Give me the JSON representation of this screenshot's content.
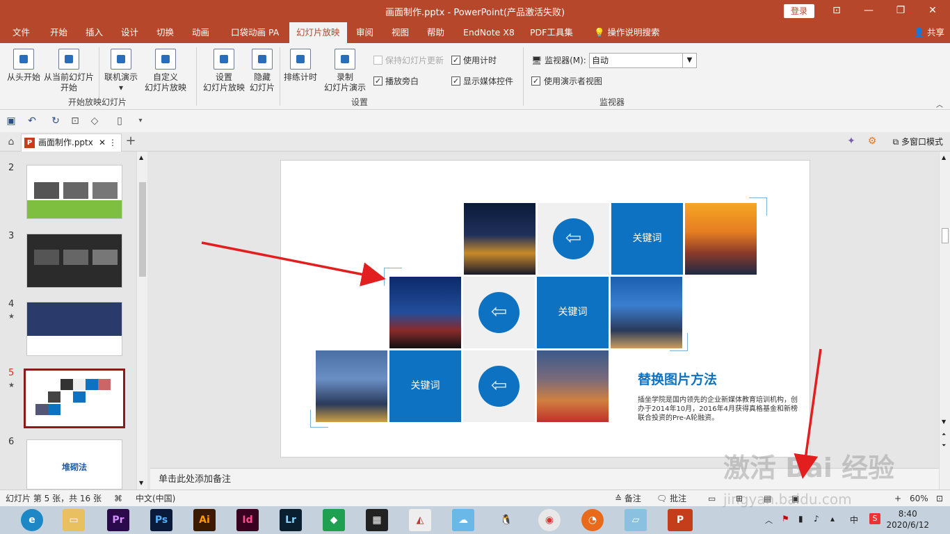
{
  "window": {
    "title": "画面制作.pptx  -  PowerPoint(产品激活失败)",
    "login_label": "登录",
    "minimize": "—",
    "restore": "❐",
    "close": "✕",
    "ribbon_display": "⊡"
  },
  "menu": {
    "tabs": [
      "文件",
      "开始",
      "插入",
      "设计",
      "切换",
      "动画",
      "口袋动画 PA",
      "幻灯片放映",
      "审阅",
      "视图",
      "帮助",
      "EndNote X8",
      "PDF工具集",
      "操作说明搜索"
    ],
    "active_tab": "幻灯片放映",
    "share": "共享"
  },
  "ribbon": {
    "from_start": "从头开始",
    "from_current_1": "从当前幻灯片",
    "from_current_2": "开始",
    "online_present": "联机演示",
    "custom_show_1": "自定义",
    "custom_show_2": "幻灯片放映",
    "group_start": "开始放映幻灯片",
    "setup_show_1": "设置",
    "setup_show_2": "幻灯片放映",
    "hide_slide_1": "隐藏",
    "hide_slide_2": "幻灯片",
    "rehearse": "排练计时",
    "record_1": "录制",
    "record_2": "幻灯片演示",
    "keep_updated": "保持幻灯片更新",
    "play_narrations": "播放旁白",
    "use_timings": "使用计时",
    "show_media_controls": "显示媒体控件",
    "group_setup": "设置",
    "monitor_label": "监视器(M):",
    "monitor_value": "自动",
    "presenter_view": "使用演示者视图",
    "group_monitors": "监视器"
  },
  "doc": {
    "tab_name": "画面制作.pptx",
    "multi_window": "多窗口模式"
  },
  "thumbnails": [
    {
      "num": "2",
      "star": ""
    },
    {
      "num": "3",
      "star": ""
    },
    {
      "num": "4",
      "star": "★"
    },
    {
      "num": "5",
      "star": "★"
    },
    {
      "num": "6",
      "star": "",
      "text": "堆砌法"
    }
  ],
  "slide": {
    "keyword": "关键词",
    "title": "替换图片方法",
    "body": "插坐学院是国内领先的企业新媒体教育培训机构，创办于2014年10月，2016年4月获得真格基金和新榜联合投资的Pre-A轮融资。"
  },
  "notes_placeholder": "单击此处添加备注",
  "status": {
    "slide_info": "幻灯片 第 5 张，共 16 张",
    "language": "中文(中国)",
    "notes": "备注",
    "comments": "批注",
    "zoom": "60%"
  },
  "taskbar": {
    "time": "8:40",
    "date": "2020/6/12",
    "ime": "中",
    "apps": [
      "Pr",
      "Ps",
      "Ai",
      "Id",
      "Lr"
    ]
  },
  "watermark": {
    "line1": "激活 Bai 经验",
    "line2": "jingyan.baidu.com"
  },
  "colors": {
    "brand": "#b7472a",
    "accent_blue": "#0e72c2",
    "arrow_red": "#e31e1e"
  }
}
